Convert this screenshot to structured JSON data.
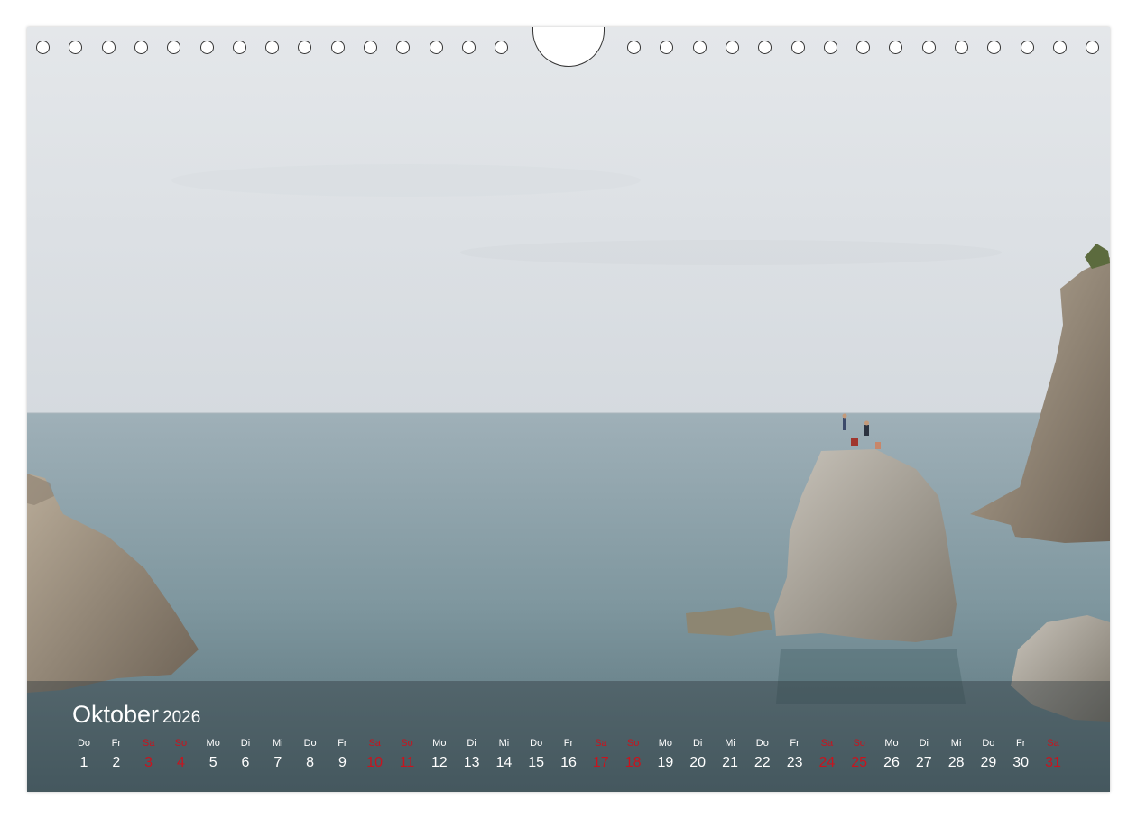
{
  "calendar": {
    "month": "Oktober",
    "year": "2026",
    "weekend_color": "#c8141e",
    "days": [
      {
        "wd": "Do",
        "num": "1",
        "weekend": false
      },
      {
        "wd": "Fr",
        "num": "2",
        "weekend": false
      },
      {
        "wd": "Sa",
        "num": "3",
        "weekend": true
      },
      {
        "wd": "So",
        "num": "4",
        "weekend": true
      },
      {
        "wd": "Mo",
        "num": "5",
        "weekend": false
      },
      {
        "wd": "Di",
        "num": "6",
        "weekend": false
      },
      {
        "wd": "Mi",
        "num": "7",
        "weekend": false
      },
      {
        "wd": "Do",
        "num": "8",
        "weekend": false
      },
      {
        "wd": "Fr",
        "num": "9",
        "weekend": false
      },
      {
        "wd": "Sa",
        "num": "10",
        "weekend": true
      },
      {
        "wd": "So",
        "num": "11",
        "weekend": true
      },
      {
        "wd": "Mo",
        "num": "12",
        "weekend": false
      },
      {
        "wd": "Di",
        "num": "13",
        "weekend": false
      },
      {
        "wd": "Mi",
        "num": "14",
        "weekend": false
      },
      {
        "wd": "Do",
        "num": "15",
        "weekend": false
      },
      {
        "wd": "Fr",
        "num": "16",
        "weekend": false
      },
      {
        "wd": "Sa",
        "num": "17",
        "weekend": true
      },
      {
        "wd": "So",
        "num": "18",
        "weekend": true
      },
      {
        "wd": "Mo",
        "num": "19",
        "weekend": false
      },
      {
        "wd": "Di",
        "num": "20",
        "weekend": false
      },
      {
        "wd": "Mi",
        "num": "21",
        "weekend": false
      },
      {
        "wd": "Do",
        "num": "22",
        "weekend": false
      },
      {
        "wd": "Fr",
        "num": "23",
        "weekend": false
      },
      {
        "wd": "Sa",
        "num": "24",
        "weekend": true
      },
      {
        "wd": "So",
        "num": "25",
        "weekend": true
      },
      {
        "wd": "Mo",
        "num": "26",
        "weekend": false
      },
      {
        "wd": "Di",
        "num": "27",
        "weekend": false
      },
      {
        "wd": "Mi",
        "num": "28",
        "weekend": false
      },
      {
        "wd": "Do",
        "num": "29",
        "weekend": false
      },
      {
        "wd": "Fr",
        "num": "30",
        "weekend": false
      },
      {
        "wd": "Sa",
        "num": "31",
        "weekend": true
      }
    ]
  }
}
